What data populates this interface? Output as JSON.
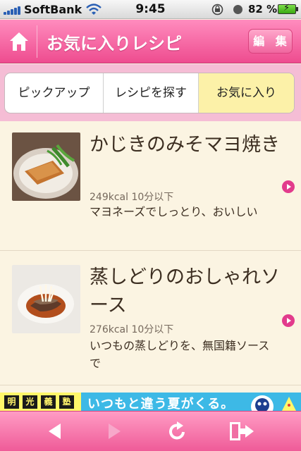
{
  "status_bar": {
    "carrier": "SoftBank",
    "time": "9:45",
    "battery_percent": "82 %"
  },
  "header": {
    "title": "お気に入りレシピ",
    "edit_label": "編 集"
  },
  "tabs": [
    {
      "label": "ピックアップ",
      "selected": false
    },
    {
      "label": "レシピを探す",
      "selected": false
    },
    {
      "label": "お気に入り",
      "selected": true
    }
  ],
  "recipes": [
    {
      "name": "かじきのみそマヨ焼き",
      "meta": "249kcal 10分以下",
      "description": "マヨネーズでしっとり、おいしい"
    },
    {
      "name": "蒸しどりのおしゃれソース",
      "meta": "276kcal 10分以下",
      "description": "いつもの蒸しどりを、無国籍ソースで"
    }
  ],
  "ad": {
    "logo_chars": [
      "明",
      "光",
      "義",
      "塾"
    ],
    "text": "いつもと違う夏がくる。"
  },
  "icons": {
    "home": "home-icon",
    "back": "back-arrow-icon",
    "forward": "forward-arrow-icon",
    "reload": "reload-icon",
    "exit": "exit-door-icon"
  },
  "colors": {
    "header_pink": "#ee4c8f",
    "selected_tab": "#fcf1a8",
    "list_background": "#fbf4e2",
    "accent_arrow": "#e23b8c"
  }
}
